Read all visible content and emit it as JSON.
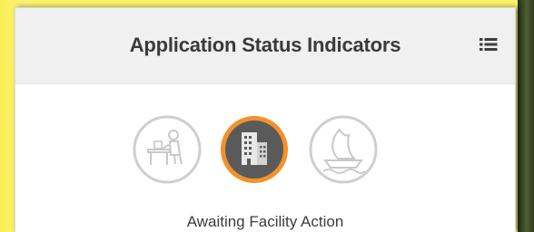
{
  "panel": {
    "title": "Application Status Indicators",
    "menu_icon": "list-menu-icon"
  },
  "statuses": [
    {
      "icon": "applicant-at-desk-icon",
      "active": false
    },
    {
      "icon": "facility-building-icon",
      "active": true
    },
    {
      "icon": "completed-ship-icon",
      "active": false
    }
  ],
  "current_status_label": "Awaiting Facility Action",
  "colors": {
    "backdrop_yellow": "#fdf26e",
    "header_bg": "#f0f0f0",
    "active_icon_fill": "#5a5a5a",
    "active_icon_ring": "#f2922a",
    "inactive_icon_stroke": "#cfcfcf",
    "title_text": "#3a3a3a"
  }
}
